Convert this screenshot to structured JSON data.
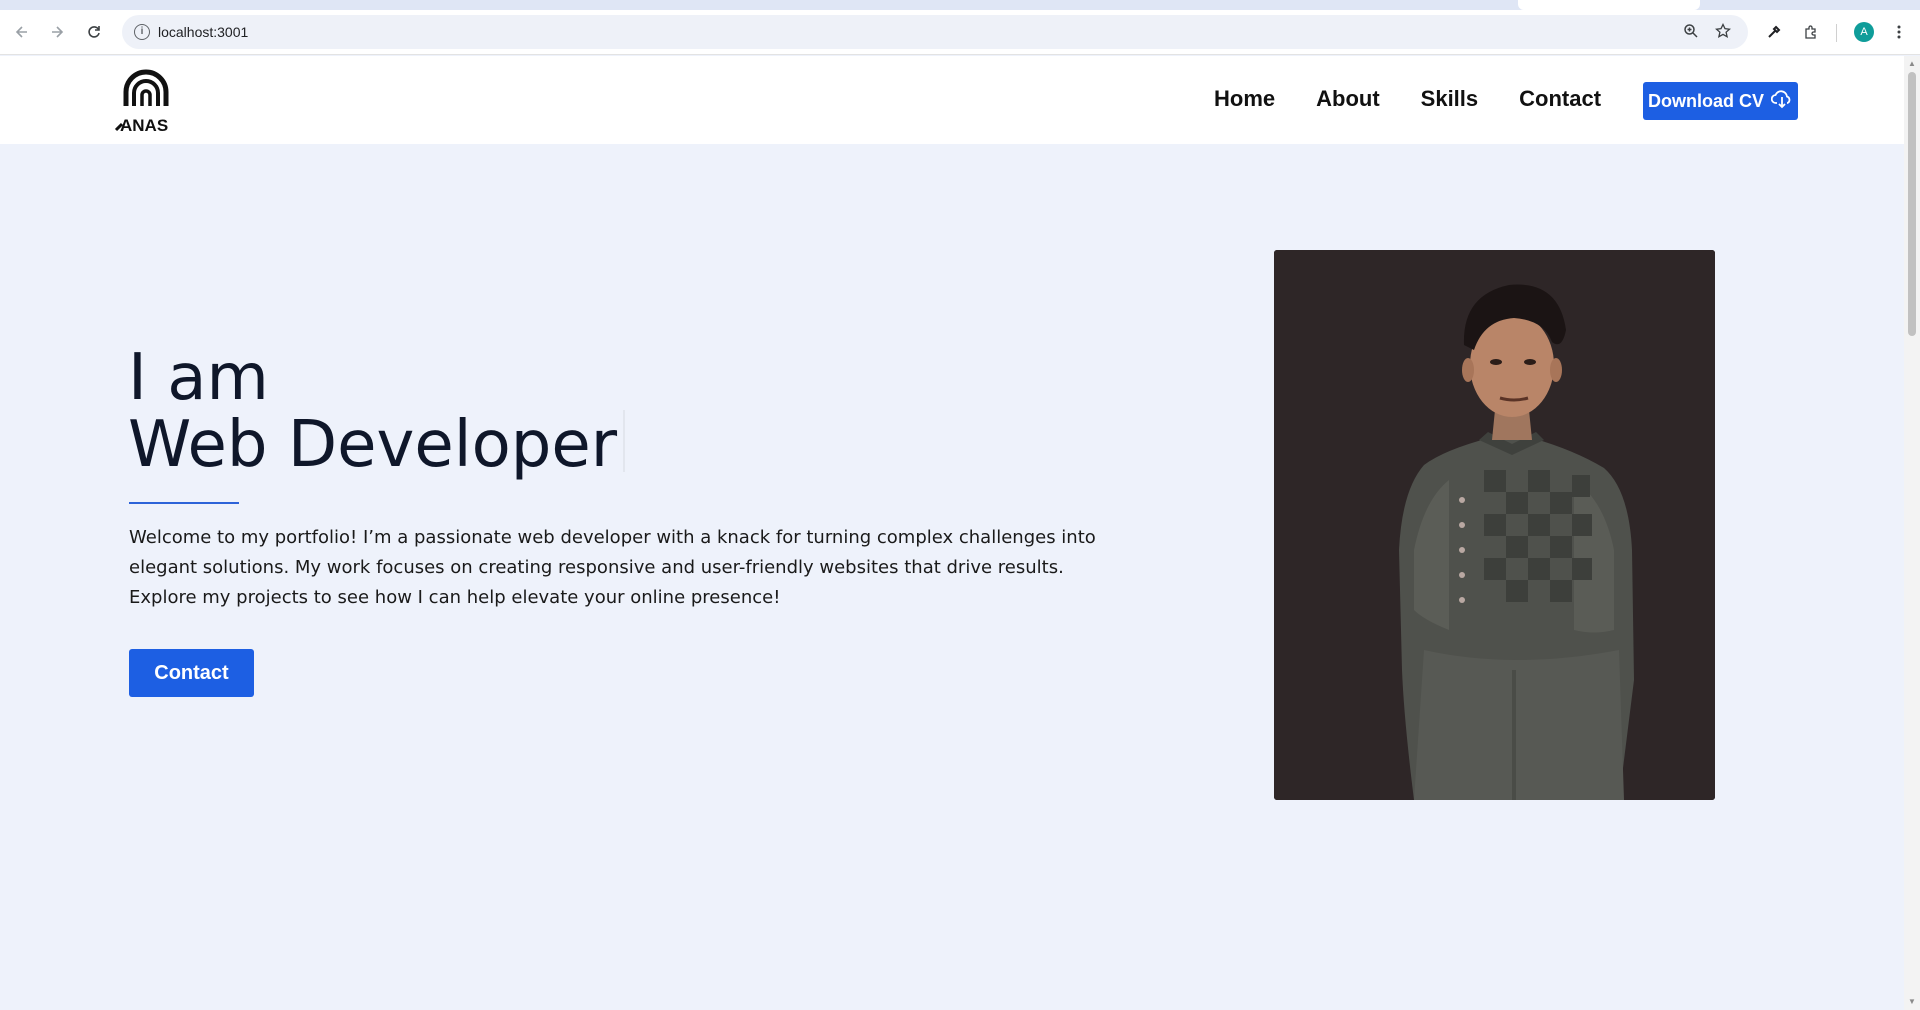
{
  "browser": {
    "url": "localhost:3001",
    "avatar_letter": "A",
    "icons": [
      "back-icon",
      "forward-icon",
      "reload-icon",
      "site-info-icon",
      "zoom-icon",
      "bookmark-star-icon",
      "eyedropper-icon",
      "extensions-icon",
      "menu-icon"
    ]
  },
  "site": {
    "logo_text": "ANAS",
    "nav": {
      "items": [
        {
          "label": "Home"
        },
        {
          "label": "About"
        },
        {
          "label": "Skills"
        },
        {
          "label": "Contact"
        }
      ],
      "download_label": "Download CV"
    },
    "hero": {
      "line1": "I am",
      "line2": "Web Developer",
      "description": "Welcome to my portfolio! I’m a passionate web developer with a knack for turning complex challenges into elegant solutions. My work focuses on creating responsive and user-friendly websites that drive results. Explore my projects to see how I can help elevate your online presence!",
      "contact_label": "Contact"
    }
  },
  "colors": {
    "accent": "#1d5fe3",
    "page_bg": "#eef2fb",
    "heading": "#0f172a",
    "photo_bg": "#2e2627"
  }
}
